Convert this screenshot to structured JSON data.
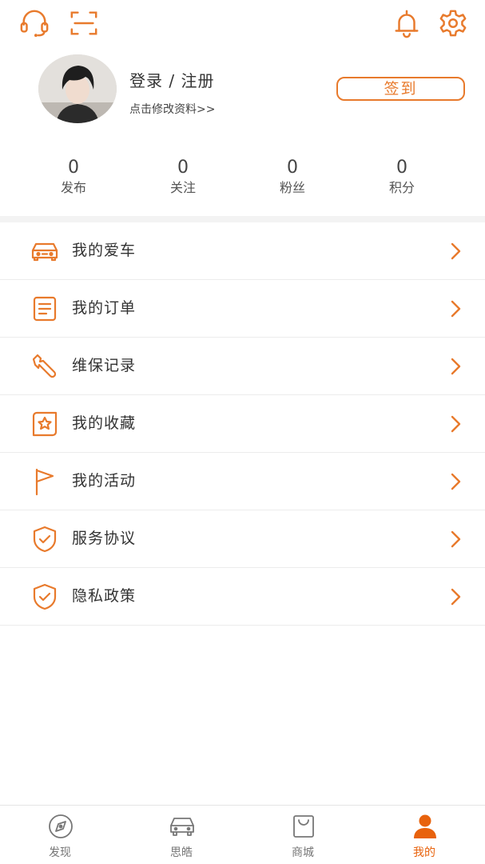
{
  "header": {
    "icons": [
      "headset-icon",
      "scan-icon",
      "bell-icon",
      "gear-icon"
    ]
  },
  "profile": {
    "title": "登录 / 注册",
    "subtitle": "点击修改资料>>",
    "checkin_label": "签到"
  },
  "stats": [
    {
      "value": "0",
      "label": "发布"
    },
    {
      "value": "0",
      "label": "关注"
    },
    {
      "value": "0",
      "label": "粉丝"
    },
    {
      "value": "0",
      "label": "积分"
    }
  ],
  "menu": [
    {
      "label": "我的爱车",
      "icon": "car-icon"
    },
    {
      "label": "我的订单",
      "icon": "order-list-icon"
    },
    {
      "label": "维保记录",
      "icon": "wrench-icon"
    },
    {
      "label": "我的收藏",
      "icon": "favorite-star-icon"
    },
    {
      "label": "我的活动",
      "icon": "flag-icon"
    },
    {
      "label": "服务协议",
      "icon": "shield-check-icon"
    },
    {
      "label": "隐私政策",
      "icon": "shield-check-icon"
    }
  ],
  "tabbar": [
    {
      "label": "发现",
      "icon": "compass-icon",
      "active": false
    },
    {
      "label": "思皓",
      "icon": "car-front-icon",
      "active": false
    },
    {
      "label": "商城",
      "icon": "shopping-bag-icon",
      "active": false
    },
    {
      "label": "我的",
      "icon": "person-icon",
      "active": true
    }
  ],
  "colors": {
    "accent": "#e87a2c",
    "active_tab": "#e8620c",
    "divider": "#f3f3f3"
  }
}
